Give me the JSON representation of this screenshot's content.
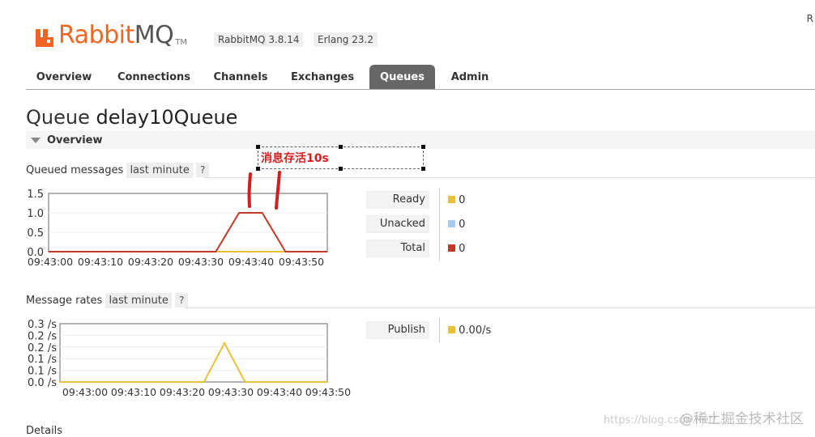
{
  "header": {
    "logo_text_rabbit": "Rabbit",
    "logo_text_mq": "MQ",
    "logo_tm": "TM",
    "rabbitmq_version": "RabbitMQ 3.8.14",
    "erlang_version": "Erlang 23.2",
    "top_right": "R"
  },
  "tabs": [
    {
      "label": "Overview"
    },
    {
      "label": "Connections"
    },
    {
      "label": "Channels"
    },
    {
      "label": "Exchanges"
    },
    {
      "label": "Queues",
      "active": true
    },
    {
      "label": "Admin"
    }
  ],
  "page": {
    "title_prefix": "Queue",
    "queue_name": "delay10Queue",
    "section": "Overview",
    "details": "Details"
  },
  "annotation": {
    "text": "消息存活10s"
  },
  "queued_messages": {
    "label": "Queued messages",
    "range": "last minute",
    "help": "?",
    "legend": [
      {
        "name": "Ready",
        "value": "0",
        "color": "#e8c13a"
      },
      {
        "name": "Unacked",
        "value": "0",
        "color": "#a6cbee"
      },
      {
        "name": "Total",
        "value": "0",
        "color": "#c0392b"
      }
    ]
  },
  "message_rates": {
    "label": "Message rates",
    "range": "last minute",
    "help": "?",
    "legend": [
      {
        "name": "Publish",
        "value": "0.00/s",
        "color": "#e8c13a"
      }
    ]
  },
  "watermark": {
    "text": "@稀土掘金技术社区",
    "url": "https://blog.csdn.net/..."
  },
  "chart_data": [
    {
      "type": "line",
      "title": "Queued messages",
      "x": [
        "09:43:00",
        "09:43:10",
        "09:43:20",
        "09:43:30",
        "09:43:40",
        "09:43:50"
      ],
      "x_ticks": [
        "09:43:00",
        "09:43:10",
        "09:43:20",
        "09:43:30",
        "09:43:40",
        "09:43:50"
      ],
      "y_ticks": [
        "1.5",
        "1.0",
        "0.5",
        "0.0"
      ],
      "ylim": [
        0,
        1.5
      ],
      "xlim": [
        0,
        60
      ],
      "series": [
        {
          "name": "Total",
          "color": "#c0392b",
          "points": [
            [
              0,
              0
            ],
            [
              36,
              0
            ],
            [
              41,
              1
            ],
            [
              46,
              1
            ],
            [
              51,
              0
            ],
            [
              60,
              0
            ]
          ]
        },
        {
          "name": "Ready",
          "color": "#e8c13a",
          "points": [
            [
              0,
              0
            ],
            [
              60,
              0
            ]
          ]
        },
        {
          "name": "Unacked",
          "color": "#a6cbee",
          "points": [
            [
              0,
              0
            ],
            [
              60,
              0
            ]
          ]
        }
      ],
      "grid": true
    },
    {
      "type": "line",
      "title": "Message rates",
      "x_ticks": [
        "09:43:00",
        "09:43:10",
        "09:43:20",
        "09:43:30",
        "09:43:40",
        "09:43:50"
      ],
      "y_ticks": [
        "0.3 /s",
        "0.2 /s",
        "0.2 /s",
        "0.1 /s",
        "0.1 /s",
        "0.0 /s"
      ],
      "ylim": [
        0,
        0.3
      ],
      "xlim": [
        0,
        65
      ],
      "series": [
        {
          "name": "Publish",
          "color": "#e8c13a",
          "points": [
            [
              0,
              0
            ],
            [
              35,
              0
            ],
            [
              40,
              0.2
            ],
            [
              45,
              0
            ],
            [
              65,
              0
            ]
          ]
        }
      ],
      "grid": true
    }
  ]
}
